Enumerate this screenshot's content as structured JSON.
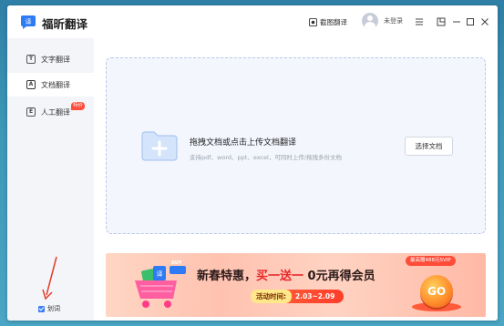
{
  "app": {
    "title": "福昕翻译"
  },
  "titlebar": {
    "screenshot_label": "截图翻译",
    "user_status": "未登录"
  },
  "sidebar": {
    "items": [
      {
        "label": "文字翻译",
        "icon": "text-translate-icon",
        "glyph": "T"
      },
      {
        "label": "文档翻译",
        "icon": "document-translate-icon",
        "glyph": "A",
        "active": true
      },
      {
        "label": "人工翻译",
        "icon": "human-translate-icon",
        "glyph": "E",
        "badge": "特价"
      }
    ],
    "checkbox_label": "划词",
    "checkbox_checked": true
  },
  "dropzone": {
    "title": "拖拽文档或点击上传文档翻译",
    "subtitle": "支持pdf、word、ppt、excel，可同时上传/拖拽多份文档",
    "button": "选择文档"
  },
  "banner": {
    "title_part1": "新春特惠，",
    "title_highlight": "买一送一",
    "title_part2": " 0元再得会员",
    "time_label": "活动时间:",
    "time_value": "2.03~2.09",
    "tag": "最高赠488元SVIP",
    "go": "GO",
    "cart_label": "BUY"
  },
  "colors": {
    "accent": "#3e7df7",
    "sidebar_bg": "#f3f5f9",
    "dropzone_bg": "#f3f6fd",
    "banner_red": "#e8262a"
  }
}
